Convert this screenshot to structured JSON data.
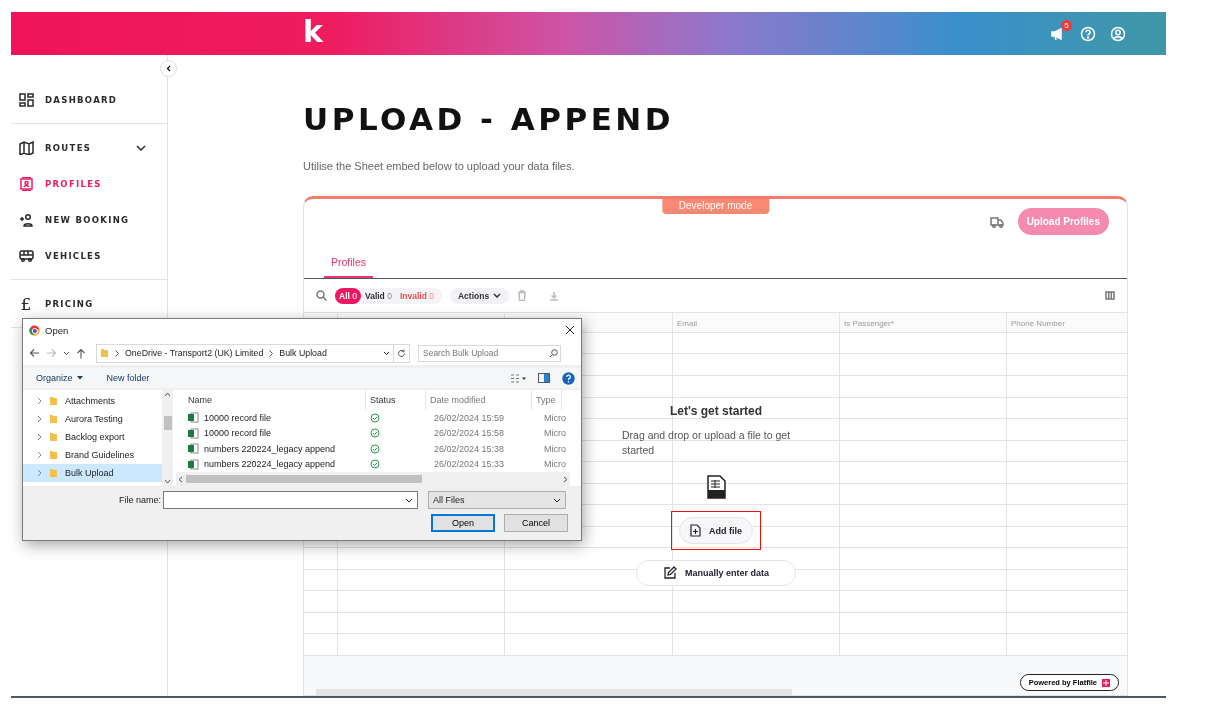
{
  "header": {
    "logo": "k",
    "notification_count": "5"
  },
  "sidebar": {
    "groups": [
      {
        "items": [
          {
            "label": "DASHBOARD",
            "kind": "link",
            "selected": false
          }
        ]
      },
      {
        "items": [
          {
            "label": "ROUTES",
            "kind": "submenu",
            "selected": false
          },
          {
            "label": "PROFILES",
            "kind": "link",
            "selected": true
          },
          {
            "label": "NEW BOOKING",
            "kind": "link",
            "selected": false
          },
          {
            "label": "VEHICLES",
            "kind": "link",
            "selected": false
          }
        ]
      },
      {
        "items": [
          {
            "label": "PRICING",
            "kind": "currency",
            "symbol": "£",
            "selected": false
          }
        ]
      }
    ]
  },
  "page": {
    "title": "UPLOAD - APPEND",
    "subtitle": "Utilise the Sheet embed below to upload your data files."
  },
  "sheet": {
    "mode_badge": "Developer mode",
    "upload_button": "Upload Profiles",
    "tabs": [
      {
        "label": "Profiles",
        "selected": true
      }
    ],
    "filters": [
      {
        "label": "All",
        "count": "0",
        "kind": "all",
        "selected": true
      },
      {
        "label": "Valid",
        "count": "0",
        "kind": "valid",
        "selected": false
      },
      {
        "label": "Invalid",
        "count": "0",
        "kind": "invalid",
        "selected": false
      }
    ],
    "actions_button": "Actions",
    "columns": [
      "Email",
      "Is Passenger*",
      "Phone Number"
    ],
    "empty_state": {
      "title": "Let's get started",
      "message": "Drag and drop or upload a file to get started",
      "add_file": "Add file",
      "manual_entry": "Manually enter data",
      "highlighted": true
    },
    "footer": "Powered by Flatfile"
  },
  "dialog": {
    "title": "Open",
    "path": [
      "OneDrive - Transport2 (UK) Limited",
      "Bulk Upload"
    ],
    "search_placeholder": "Search Bulk Upload",
    "toolbar": [
      "Organize",
      "New folder"
    ],
    "folders": [
      {
        "label": "Attachments",
        "selected": false
      },
      {
        "label": "Aurora Testing",
        "selected": false
      },
      {
        "label": "Backlog export",
        "selected": false
      },
      {
        "label": "Brand Guidelines",
        "selected": false
      },
      {
        "label": "Bulk Upload",
        "selected": true
      }
    ],
    "columns": [
      "Name",
      "Status",
      "Date modified",
      "Type"
    ],
    "files": [
      {
        "name": "10000 record file",
        "date": "26/02/2024 15:59",
        "type": "Micro"
      },
      {
        "name": "10000 record file",
        "date": "26/02/2024 15:58",
        "type": "Micro"
      },
      {
        "name": "numbers 220224_legacy append",
        "date": "26/02/2024 15:38",
        "type": "Micro"
      },
      {
        "name": "numbers 220224_legacy append",
        "date": "26/02/2024 15:33",
        "type": "Micro"
      }
    ],
    "file_name_label": "File name:",
    "file_type": "All Files",
    "buttons": [
      "Open",
      "Cancel"
    ]
  }
}
